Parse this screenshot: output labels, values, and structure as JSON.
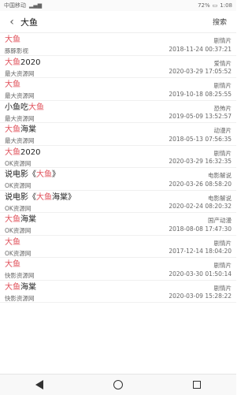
{
  "statusbar": {
    "carrier": "中国移动",
    "signal_icon": "signal-icon",
    "battery_icon": "battery-icon",
    "time": "1:08",
    "battery_pct": "72%"
  },
  "header": {
    "back_icon": "back-icon",
    "query": "大鱼",
    "search_label": "搜索"
  },
  "results": [
    {
      "title_pre": "",
      "title_hl": "大鱼",
      "title_post": "",
      "source": "豚豚影视",
      "tag": "剧情片",
      "time": "2018-11-24 00:37:21"
    },
    {
      "title_pre": "",
      "title_hl": "大鱼",
      "title_post": "2020",
      "source": "最大资源网",
      "tag": "爱情片",
      "time": "2020-03-29 17:05:52"
    },
    {
      "title_pre": "",
      "title_hl": "大鱼",
      "title_post": "",
      "source": "最大资源网",
      "tag": "剧情片",
      "time": "2019-10-18 08:25:55"
    },
    {
      "title_pre": "小鱼吃",
      "title_hl": "大鱼",
      "title_post": "",
      "source": "最大资源网",
      "tag": "恐怖片",
      "time": "2019-05-09 13:52:57"
    },
    {
      "title_pre": "",
      "title_hl": "大鱼",
      "title_post": "海棠",
      "source": "最大资源网",
      "tag": "动漫片",
      "time": "2018-05-13 07:56:35"
    },
    {
      "title_pre": "",
      "title_hl": "大鱼",
      "title_post": "2020",
      "source": "OK资源网",
      "tag": "剧情片",
      "time": "2020-03-29 16:32:35"
    },
    {
      "title_pre": "说电影《",
      "title_hl": "大鱼",
      "title_post": "》",
      "source": "OK资源网",
      "tag": "电影解说",
      "time": "2020-03-26 08:58:20"
    },
    {
      "title_pre": "说电影《",
      "title_hl": "大鱼",
      "title_post": "海棠》",
      "source": "OK资源网",
      "tag": "电影解说",
      "time": "2020-02-24 08:20:32"
    },
    {
      "title_pre": "",
      "title_hl": "大鱼",
      "title_post": "海棠",
      "source": "OK资源网",
      "tag": "国产动漫",
      "time": "2018-08-08 17:47:30"
    },
    {
      "title_pre": "",
      "title_hl": "大鱼",
      "title_post": "",
      "source": "OK资源网",
      "tag": "剧情片",
      "time": "2017-12-14 18:04:20"
    },
    {
      "title_pre": "",
      "title_hl": "大鱼",
      "title_post": "",
      "source": "快影资源网",
      "tag": "剧情片",
      "time": "2020-03-30 01:50:14"
    },
    {
      "title_pre": "",
      "title_hl": "大鱼",
      "title_post": "海棠",
      "source": "快影资源网",
      "tag": "剧情片",
      "time": "2020-03-09 15:28:22"
    }
  ],
  "navbar": {
    "back_icon": "nav-back-icon",
    "home_icon": "nav-home-icon",
    "recents_icon": "nav-recents-icon"
  },
  "colors": {
    "highlight": "#e0505a"
  }
}
